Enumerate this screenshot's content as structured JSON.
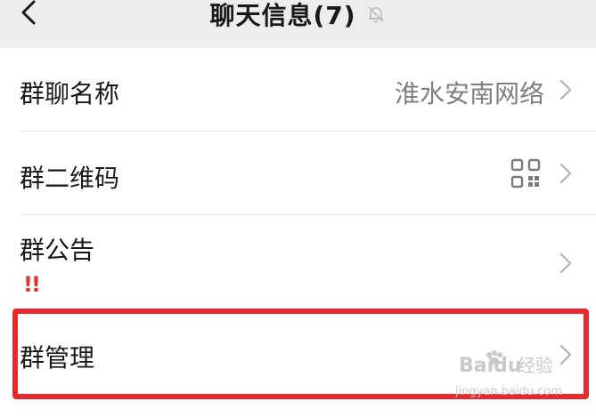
{
  "header": {
    "title": "聊天信息(7)",
    "back_icon": "chevron-left-icon",
    "mute_icon": "bell-off-icon"
  },
  "rows": [
    {
      "label": "群聊名称",
      "value": "淮水安南网络"
    },
    {
      "label": "群二维码",
      "icon": "qr-code-icon"
    },
    {
      "label": "群公告",
      "badge": "!!"
    },
    {
      "label": "群管理"
    }
  ],
  "watermark": {
    "brand": "Baidu",
    "brand_suffix": "经验",
    "url": "jingyan.baidu.com"
  },
  "colors": {
    "highlight": "#e8292c",
    "warning": "#e0322d"
  }
}
